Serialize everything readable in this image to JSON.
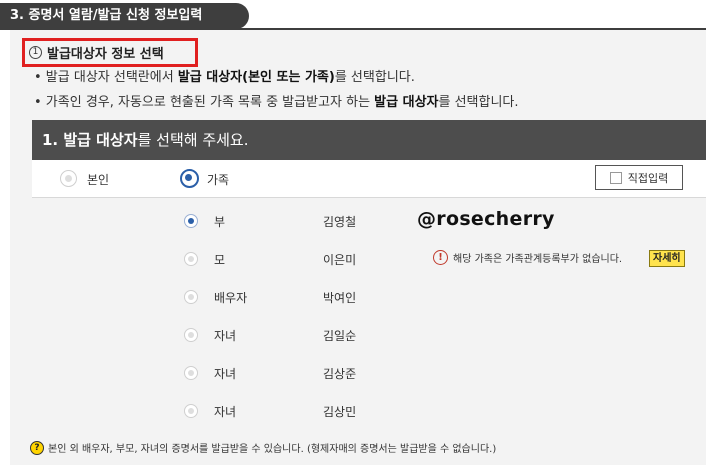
{
  "section": {
    "title": "3. 증명서 열람/발급 신청 정보입력"
  },
  "subsection": {
    "number": "1",
    "title": "발급대상자 정보 선택"
  },
  "bullets": [
    {
      "dot": "•",
      "pre": " 발급 대상자 선택란에서 ",
      "bold": "발급 대상자(본인 또는 가족)",
      "post": "를 선택합니다."
    },
    {
      "dot": "•",
      "pre": " 가족인 경우, 자동으로 현출된 가족 목록 중 발급받고자 하는 ",
      "bold": "발급 대상자",
      "post": "를 선택합니다."
    }
  ],
  "panel": {
    "head_bold": "1. 발급 대상자",
    "head_rest": "를 선택해 주세요."
  },
  "choices": {
    "self_label": "본인",
    "family_label": "가족",
    "selected": "가족",
    "direct_input_label": "직접입력"
  },
  "family": [
    {
      "relation": "부",
      "name": "김영철",
      "selected": true
    },
    {
      "relation": "모",
      "name": "이은미",
      "selected": false,
      "warning": "해당 가족은 가족관계등록부가 없습니다.",
      "detail_label": "자세히"
    },
    {
      "relation": "배우자",
      "name": "박여인",
      "selected": false
    },
    {
      "relation": "자녀",
      "name": "김일순",
      "selected": false
    },
    {
      "relation": "자녀",
      "name": "김상준",
      "selected": false
    },
    {
      "relation": "자녀",
      "name": "김상민",
      "selected": false
    }
  ],
  "watermark": "@rosecherry",
  "footer_note": "본인 외 배우자, 부모, 자녀의 증명서를 발급받을 수 있습니다. (형제자매의 증명서는 발급받을 수 없습니다.)",
  "icons": {
    "warning": "!",
    "question": "?"
  },
  "colors": {
    "accent": "#2b5fa8",
    "highlight_border": "#e02020",
    "detail_button": "#ffe34d",
    "header_dark": "#4d4d4d"
  }
}
